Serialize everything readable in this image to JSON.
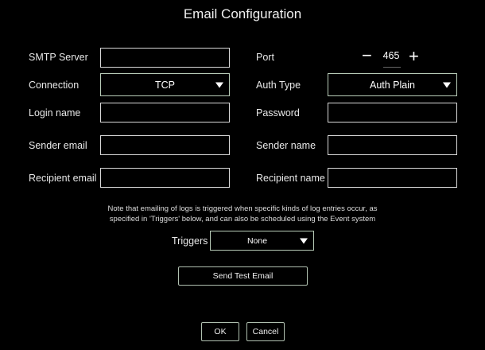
{
  "title": "Email Configuration",
  "fields": {
    "smtp_server": {
      "label": "SMTP Server",
      "value": ""
    },
    "port": {
      "label": "Port",
      "value": "465",
      "minus": "−",
      "plus": "+"
    },
    "connection": {
      "label": "Connection",
      "value": "TCP"
    },
    "auth_type": {
      "label": "Auth Type",
      "value": "Auth Plain"
    },
    "login_name": {
      "label": "Login name",
      "value": ""
    },
    "password": {
      "label": "Password",
      "value": ""
    },
    "sender_email": {
      "label": "Sender email",
      "value": ""
    },
    "sender_name": {
      "label": "Sender name",
      "value": ""
    },
    "recipient_email": {
      "label": "Recipient email",
      "value": ""
    },
    "recipient_name": {
      "label": "Recipient name",
      "value": ""
    }
  },
  "note": {
    "line1": "Note that emailing of logs is triggered when specific kinds of log entries occur, as",
    "line2": "specified in 'Triggers' below, and can also be scheduled using the Event system"
  },
  "triggers": {
    "label": "Triggers",
    "value": "None"
  },
  "buttons": {
    "send_test": "Send Test Email",
    "ok": "OK",
    "cancel": "Cancel"
  },
  "colors": {
    "background": "#000000",
    "border": "#d8d8d8",
    "select_border": "#b8ccb8"
  }
}
